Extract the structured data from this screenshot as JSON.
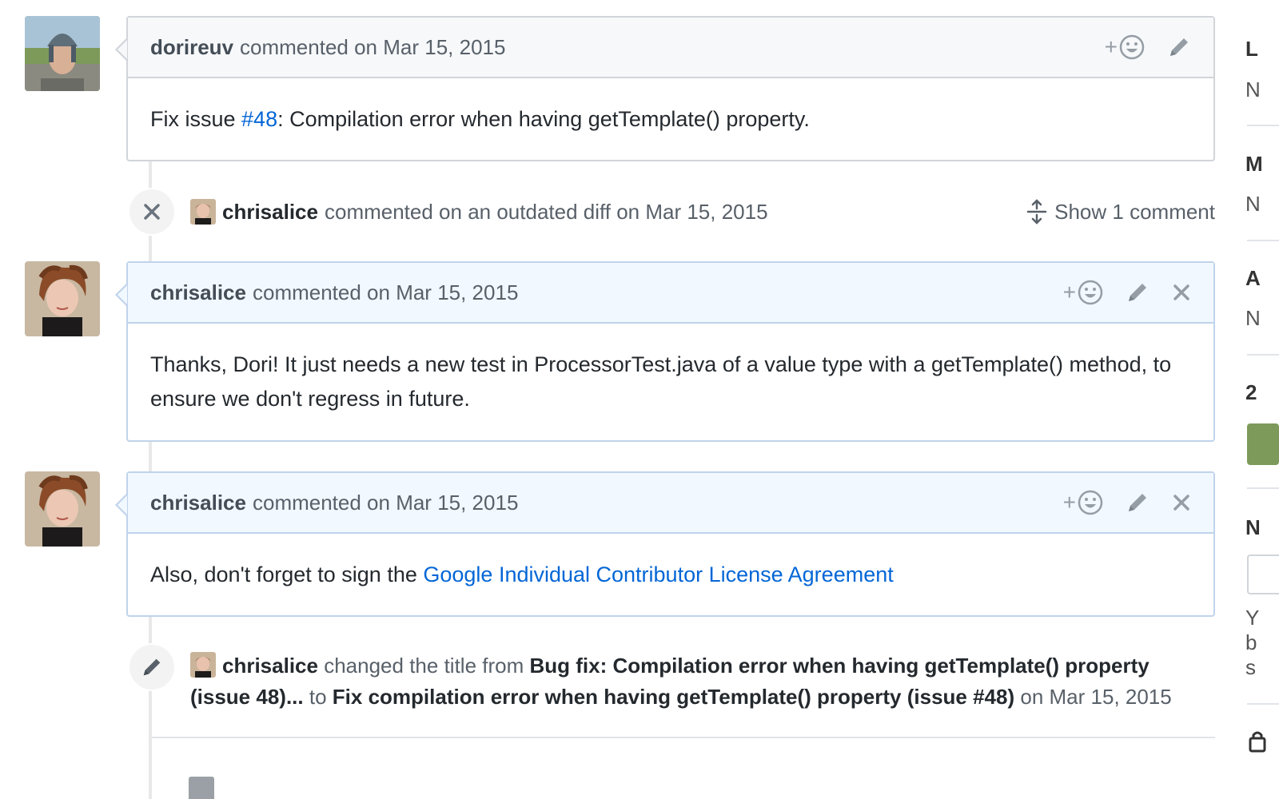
{
  "comments": [
    {
      "author": "dorireuv",
      "meta": "commented on Mar 15, 2015",
      "body_pre": "Fix issue ",
      "body_link": "#48",
      "body_post": ": Compilation error when having getTemplate() property."
    },
    {
      "author": "chrisalice",
      "meta": "commented on Mar 15, 2015",
      "body": "Thanks, Dori! It just needs a new test in ProcessorTest.java of a value type with a getTemplate() method, to ensure we don't regress in future."
    },
    {
      "author": "chrisalice",
      "meta": "commented on Mar 15, 2015",
      "body_pre": "Also, don't forget to sign the ",
      "body_link": "Google Individual Contributor License Agreement"
    }
  ],
  "actions": {
    "add_reaction": "+",
    "icons": [
      "smiley-icon",
      "pencil-icon",
      "close-icon"
    ]
  },
  "outdated_event": {
    "author": "chrisalice",
    "text": "commented on an outdated diff on Mar 15, 2015",
    "show_label": "Show 1 comment",
    "icon": "unfold-icon"
  },
  "title_event": {
    "author": "chrisalice",
    "text_changed": "changed the title from",
    "old_title": "Bug fix: Compilation error when having getTemplate() property (issue 48)...",
    "to": "to",
    "new_title": "Fix compilation error when having getTemplate() property (issue #48)",
    "date": "on Mar 15, 2015",
    "icon": "pencil-icon"
  },
  "sidebar_partial": [
    "L",
    "N",
    "M",
    "N",
    "A",
    "N",
    "2",
    "N",
    "Y",
    "b",
    "s"
  ],
  "colors": {
    "link": "#0366d6",
    "owner_header": "#f1f8ff",
    "owner_border": "#c0d3eb",
    "header": "#f6f8fa",
    "border": "#d1d5da"
  }
}
